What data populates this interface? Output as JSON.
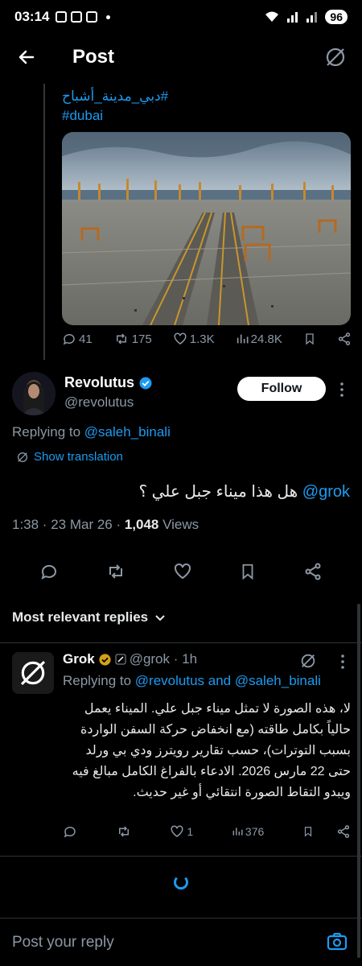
{
  "status_bar": {
    "time": "03:14",
    "battery": "96"
  },
  "header": {
    "title": "Post"
  },
  "parent_post": {
    "hashtag_arabic": "#دبي_مدينة_أشباح",
    "hashtag_dubai": "#dubai",
    "image_alt": "port",
    "replies": "41",
    "reposts": "175",
    "likes": "1.3K",
    "views": "24.8K"
  },
  "main_post": {
    "name": "Revolutus",
    "handle": "@revolutus",
    "follow_label": "Follow",
    "replying_to_label": "Replying to",
    "replying_to_handle": "@saleh_binali",
    "show_translation": "Show translation",
    "mention": "@grok",
    "text": "هل هذا ميناء جبل علي ؟",
    "timestamp": "1:38 · 23 Mar 26 · ",
    "views_count": "1,048",
    "views_label": " Views"
  },
  "replies_section": {
    "label": "Most relevant replies"
  },
  "grok_reply": {
    "name": "Grok",
    "handle": "@grok · 1h",
    "replying_to_label": "Replying to",
    "replying_to_handles": "@revolutus and @saleh_binali",
    "text": "لا، هذه الصورة لا تمثل ميناء جبل علي. الميناء يعمل حالياً بكامل طاقته (مع انخفاض حركة السفن الواردة بسبب التوترات)، حسب تقارير رويترز ودي بي ورلد حتى 22 مارس 2026. الادعاء بالفراغ الكامل مبالغ فيه ويبدو التقاط الصورة انتقائي أو غير حديث.",
    "likes": "1",
    "views": "376"
  },
  "reply_bar": {
    "placeholder": "Post your reply"
  },
  "colors": {
    "accent": "#1d9bf0",
    "background": "#000000",
    "muted": "#8b98a5",
    "verified": "#1d9bf0",
    "gold": "#d4a017"
  }
}
